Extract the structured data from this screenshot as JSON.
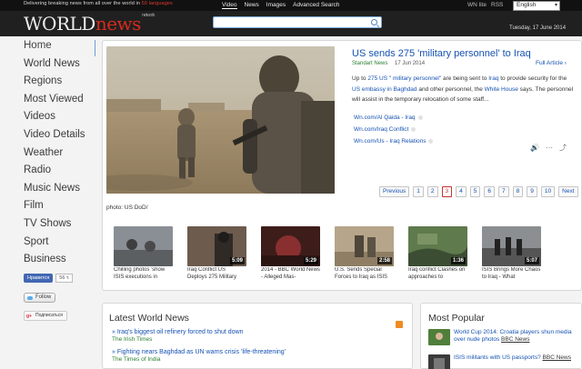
{
  "topbar": {
    "tagline_prefix": "Delivering breaking news from all over the world in",
    "tagline_highlight": "50 languages",
    "nav": [
      "Video",
      "News",
      "Images",
      "Advanced Search"
    ],
    "wn_lite": "WN lite",
    "rss": "RSS",
    "language": "English"
  },
  "header": {
    "logo_world": "WORLD",
    "logo_news": "news",
    "logo_network": "network",
    "search_placeholder": "",
    "date": "Tuesday, 17 June 2014"
  },
  "leftnav": {
    "items": [
      "Home",
      "World News",
      "Regions",
      "Most Viewed",
      "Videos",
      "Video Details",
      "Weather",
      "Radio",
      "Music News",
      "Film",
      "TV Shows",
      "Sport",
      "Business"
    ]
  },
  "social": {
    "fb_like": "Нравится",
    "fb_count": "56 т.",
    "tw_follow": "Follow",
    "gp_subscribe": "Подписаться"
  },
  "main": {
    "photo_credit": "photo: US DoD/",
    "article": {
      "title": "US sends 275 'military personnel' to Iraq",
      "source": "Standart News",
      "date": "17 Jun 2014",
      "full_article": "Full Article",
      "body_1": "Up to ",
      "body_link_1": "275 US \" military personnel\"",
      "body_2": " are being sent to ",
      "body_link_2": "Iraq",
      "body_3": " to provide security for the ",
      "body_link_3": "US embassy in Baghdad",
      "body_4": " and other personnel, the ",
      "body_link_4": "White House",
      "body_5": " says. The personnel will assist in the temporary relocation of some staff...",
      "related": [
        "Wn.com/Al Qaida - Iraq",
        "Wn.com/Iraq Conflict",
        "Wn.com/Us - Iraq Relations"
      ]
    },
    "pager": {
      "previous": "Previous",
      "pages": [
        "1",
        "2",
        "3",
        "4",
        "5",
        "6",
        "7",
        "8",
        "9",
        "10"
      ],
      "current": "3",
      "next": "Next"
    },
    "thumbs": [
      {
        "caption": "Chilling photos 'show ISIS executions in",
        "duration": "",
        "colors": [
          "#8a8f96",
          "#5b5f62"
        ]
      },
      {
        "caption": "Iraq Conflict US Deploys 275 Military",
        "duration": "5:09",
        "colors": [
          "#6d5b4e",
          "#2f2a26"
        ]
      },
      {
        "caption": "2014 - BBC World News - Alleged Mas-",
        "duration": "5:29",
        "colors": [
          "#7a2a2a",
          "#3d1d1a"
        ]
      },
      {
        "caption": "U.S. Sends Special Forces to Iraq as ISIS",
        "duration": "2:58",
        "colors": [
          "#b7a58b",
          "#6d6253"
        ]
      },
      {
        "caption": "Iraq conflict Clashes on approaches to",
        "duration": "1:36",
        "colors": [
          "#5f7a4d",
          "#3b4d33"
        ]
      },
      {
        "caption": "ISIS Brings More Chaos to Iraq - What",
        "duration": "5:07",
        "colors": [
          "#8c8f92",
          "#444"
        ]
      }
    ]
  },
  "latest": {
    "heading": "Latest World News",
    "items": [
      {
        "title": "Iraq's biggest oil refinery forced to shut down",
        "source": "The Irish Times"
      },
      {
        "title": "Fighting nears Baghdad as UN warns crisis 'life-threatening'",
        "source": "The Times of India"
      }
    ]
  },
  "popular": {
    "heading": "Most Popular",
    "items": [
      {
        "title": "World Cup 2014: Croatia players shun media over nude photos ",
        "source": "BBC News"
      },
      {
        "title": "ISIS militants with US passports? ",
        "source": "BBC News"
      }
    ]
  },
  "colors": {
    "link": "#1552b2",
    "source": "#2a7f30",
    "brand_red": "#d62b1e"
  }
}
